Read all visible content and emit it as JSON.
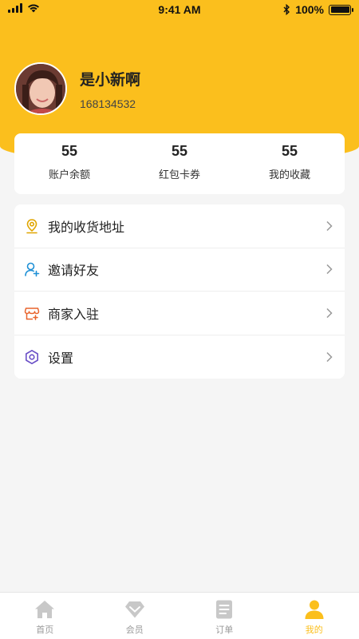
{
  "status_bar": {
    "time": "9:41 AM",
    "battery": "100%"
  },
  "profile": {
    "name": "是小新啊",
    "id": "168134532"
  },
  "stats": [
    {
      "value": "55",
      "label": "账户余额"
    },
    {
      "value": "55",
      "label": "红包卡券"
    },
    {
      "value": "55",
      "label": "我的收藏"
    }
  ],
  "menu": [
    {
      "label": "我的收货地址",
      "icon": "location-pin-icon",
      "color": "#e0a500"
    },
    {
      "label": "邀请好友",
      "icon": "add-user-icon",
      "color": "#1e90d6"
    },
    {
      "label": "商家入驻",
      "icon": "store-icon",
      "color": "#e8632b"
    },
    {
      "label": "设置",
      "icon": "settings-hexagon-icon",
      "color": "#6a4fc7"
    }
  ],
  "tabbar": [
    {
      "label": "首页",
      "icon": "home-icon"
    },
    {
      "label": "会员",
      "icon": "diamond-icon"
    },
    {
      "label": "订单",
      "icon": "order-list-icon"
    },
    {
      "label": "我的",
      "icon": "user-icon",
      "active": true
    }
  ],
  "colors": {
    "accent": "#fbbf1d",
    "background": "#f5f5f5"
  }
}
